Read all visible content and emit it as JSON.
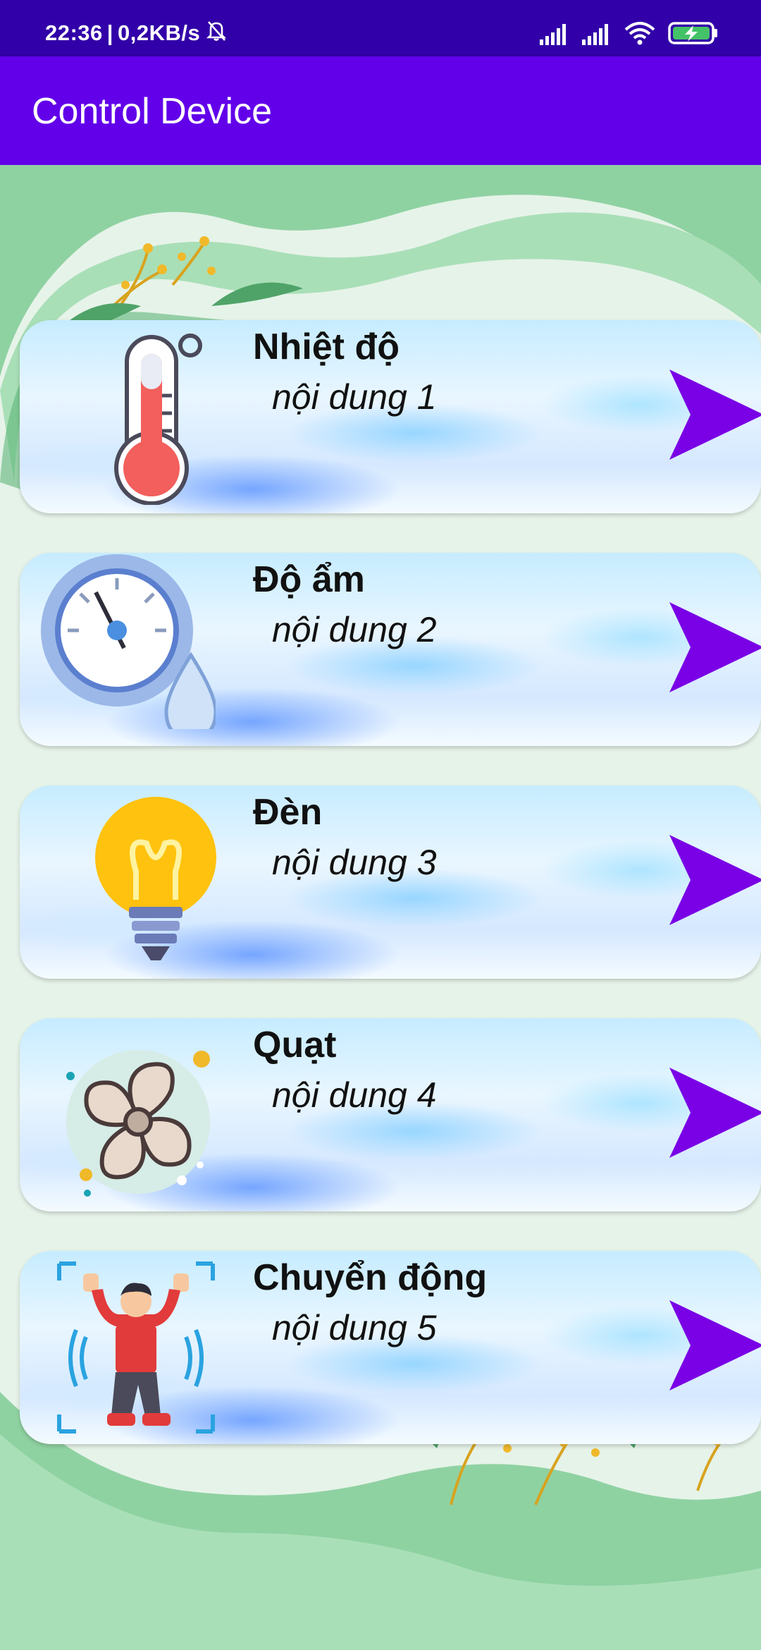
{
  "status_bar": {
    "time": "22:36",
    "separator": "|",
    "speed": "0,2KB/s"
  },
  "app_bar": {
    "title": "Control Device"
  },
  "cards": [
    {
      "title": "Nhiệt độ",
      "subtitle": "nội dung 1",
      "icon": "thermometer-icon"
    },
    {
      "title": "Độ ẩm",
      "subtitle": "nội dung 2",
      "icon": "humidity-gauge-icon"
    },
    {
      "title": "Đèn",
      "subtitle": "nội dung 3",
      "icon": "light-bulb-icon"
    },
    {
      "title": "Quạt",
      "subtitle": "nội dung 4",
      "icon": "fan-icon"
    },
    {
      "title": "Chuyển động",
      "subtitle": "nội dung 5",
      "icon": "motion-person-icon"
    }
  ],
  "colors": {
    "status_bar": "#3200a8",
    "app_bar": "#6200ea",
    "arrow": "#7a00e6",
    "card_background": "#d5ecff"
  }
}
